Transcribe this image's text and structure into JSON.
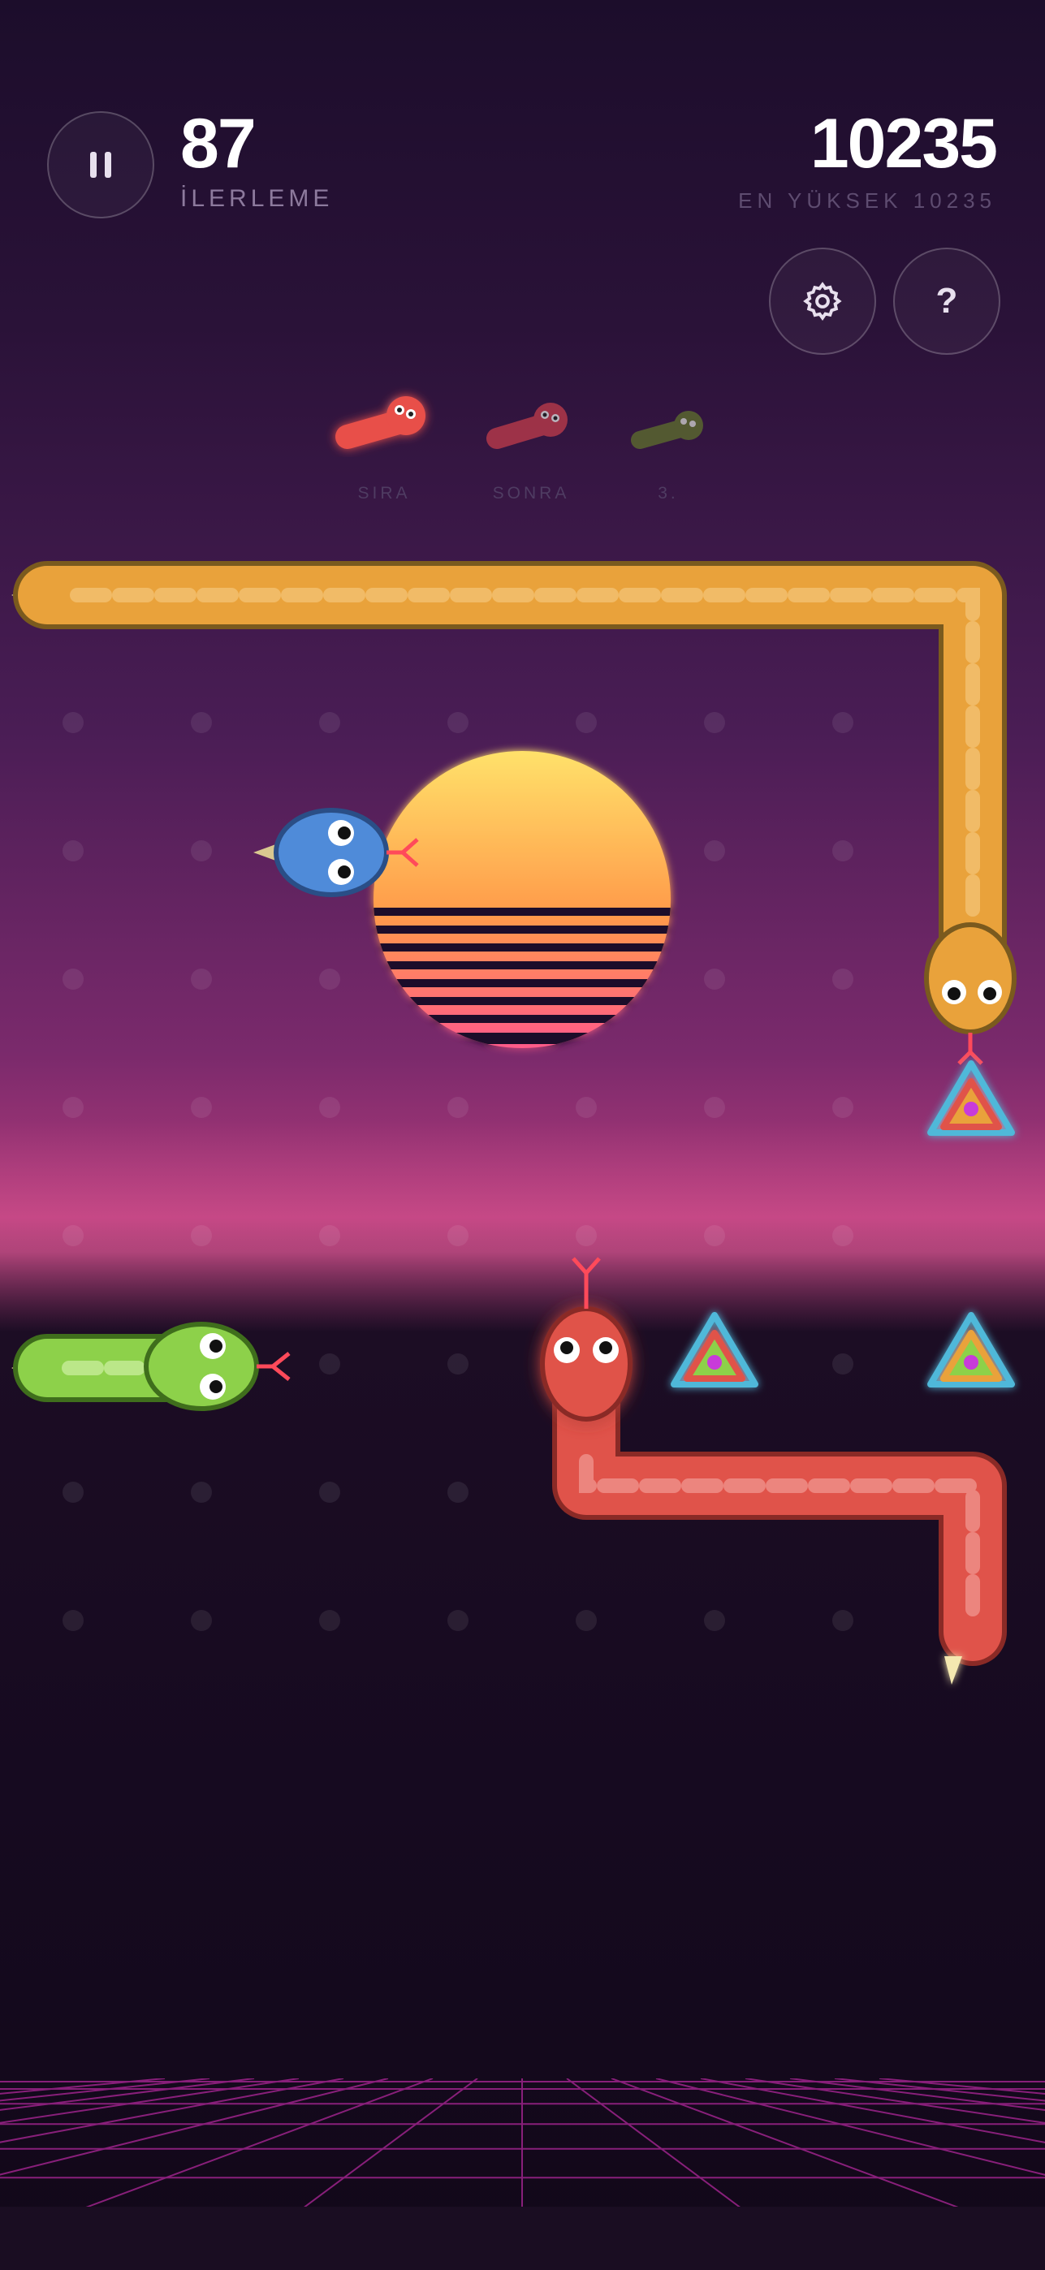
{
  "hud": {
    "pause_icon": "pause-icon",
    "progress_value": "87",
    "progress_label": "İLERLEME",
    "score_value": "10235",
    "best_label": "EN YÜKSEK 10235",
    "settings_icon": "gear-icon",
    "help_label": "?"
  },
  "queue": {
    "items": [
      {
        "label": "SIRA",
        "color": "#e84f4a"
      },
      {
        "label": "SONRA",
        "color": "#b83a4a"
      },
      {
        "label": "3.",
        "color": "#5c6b2e"
      }
    ]
  },
  "snakes": [
    {
      "name": "orange",
      "color": "#e9a23b"
    },
    {
      "name": "blue",
      "color": "#4f8bd9"
    },
    {
      "name": "green",
      "color": "#8dd14a"
    },
    {
      "name": "red",
      "color": "#e0534a"
    }
  ],
  "colors": {
    "sun_top": "#ffe16a",
    "sun_bottom": "#ff5a8a",
    "grid_line": "#b0279a"
  }
}
